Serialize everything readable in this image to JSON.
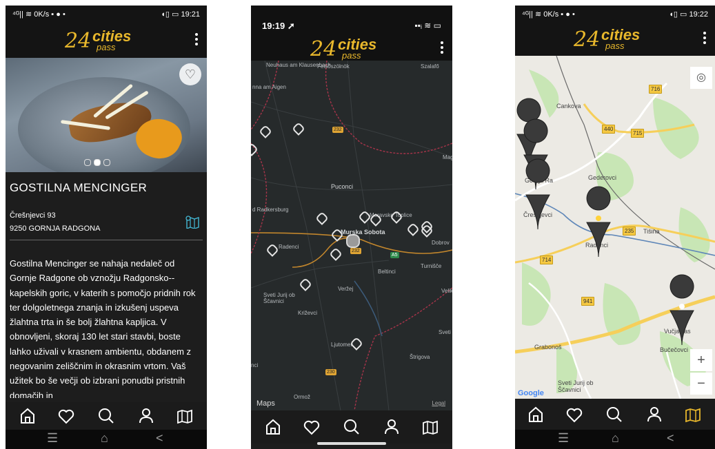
{
  "phone1": {
    "status": {
      "left": "⁴ᴳ|| ≋ 0K/s ▪ ● •",
      "right": "◖▯ ▭ 19:21"
    },
    "restaurant": {
      "name": "GOSTILNA MENCINGER",
      "street": "Črešnjevci 93",
      "city": "9250 GORNJA RADGONA",
      "description": "Gostilna Mencinger se nahaja nedaleč od Gornje Radgone ob vznožju Radgonsko--kapelskih goric, v katerih s pomočjo pridnih rok ter dolgoletnega znanja in izkušenj uspeva žlahtna trta in še bolj žlahtna kapljica. V obnovljeni, skoraj 130 let stari stavbi, boste lahko uživali v krasnem ambientu, obdanem z negovanim zeliščnim in okrasnim vrtom. Vaš užitek bo še večji ob izbrani ponudbi pristnih domačih in"
    },
    "carousel": {
      "count": 3,
      "active": 2
    }
  },
  "phone2": {
    "status": {
      "time": "19:19 ➚",
      "right": "▪▪ᵢ ≋ ▭"
    },
    "map": {
      "places": [
        "Felsőszölnök",
        "Szalafő",
        "Neuhaus am Klausenbach",
        "nna am Aigen",
        "Puconci",
        "d Radkersburg",
        "Moravske Toplice",
        "Murska Sobota",
        "Radenci",
        "Dobrov",
        "Beltinci",
        "Turnišče",
        "Veržej",
        "Sveti Jurij ob Ščavnici",
        "Križevci",
        "Velik",
        "Ljutomer",
        "Sveti Ma",
        "Štrigova",
        "Ormož",
        "Magy",
        "nci"
      ],
      "roads": [
        "232",
        "232",
        "A5",
        "230"
      ],
      "attribution": "Maps",
      "legal": "Legal"
    }
  },
  "phone3": {
    "status": {
      "left": "⁴ᴳ|| ≋ 0K/s ▪ ● •",
      "right": "◖▯ ▭ 19:22"
    },
    "map": {
      "places": [
        "Cankova",
        "Gornja Ra",
        "Gederovci",
        "Črešnjevci",
        "Radenci",
        "Tišina",
        "Vučja vas",
        "Grabonoš",
        "Bučečovci",
        "Sveti Jurij ob Ščavnici"
      ],
      "roads": [
        "716",
        "440",
        "715",
        "235",
        "714",
        "941"
      ],
      "zoom_in": "+",
      "zoom_out": "−",
      "attribution": "Google"
    }
  },
  "logo": {
    "num": "24",
    "cities": "cities",
    "pass": "pass"
  },
  "tabs": [
    {
      "name": "home"
    },
    {
      "name": "favorites"
    },
    {
      "name": "search"
    },
    {
      "name": "profile"
    },
    {
      "name": "map"
    }
  ],
  "colors": {
    "accent": "#e9b82c",
    "bg": "#1d1d1d"
  },
  "androidnav": {
    "menu": "☰",
    "home": "⌂",
    "back": "<"
  }
}
